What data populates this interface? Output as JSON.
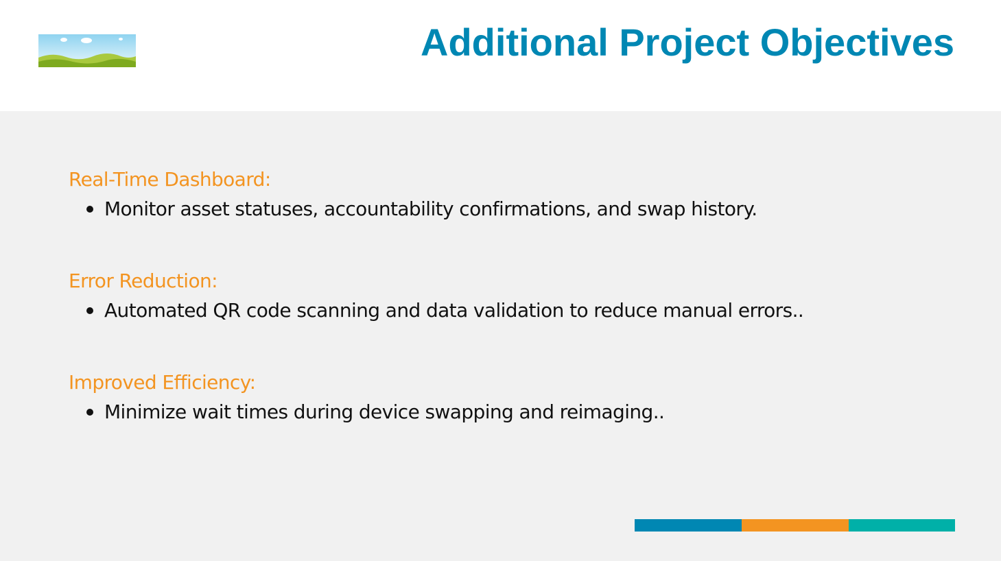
{
  "slide": {
    "title": "Additional Project Objectives"
  },
  "sections": [
    {
      "heading": "Real-Time Dashboard:",
      "bullet": "Monitor asset statuses, accountability confirmations, and swap history."
    },
    {
      "heading": "Error Reduction:",
      "bullet": "Automated QR code scanning and data validation to reduce manual errors.."
    },
    {
      "heading": "Improved Efficiency:",
      "bullet": "Minimize wait times during device swapping and reimaging.."
    }
  ],
  "colors": {
    "title": "#0087b3",
    "heading": "#f39421",
    "background": "#f1f1f1",
    "accent_blue": "#0087b3",
    "accent_orange": "#f39421",
    "accent_teal": "#00b0a8"
  }
}
